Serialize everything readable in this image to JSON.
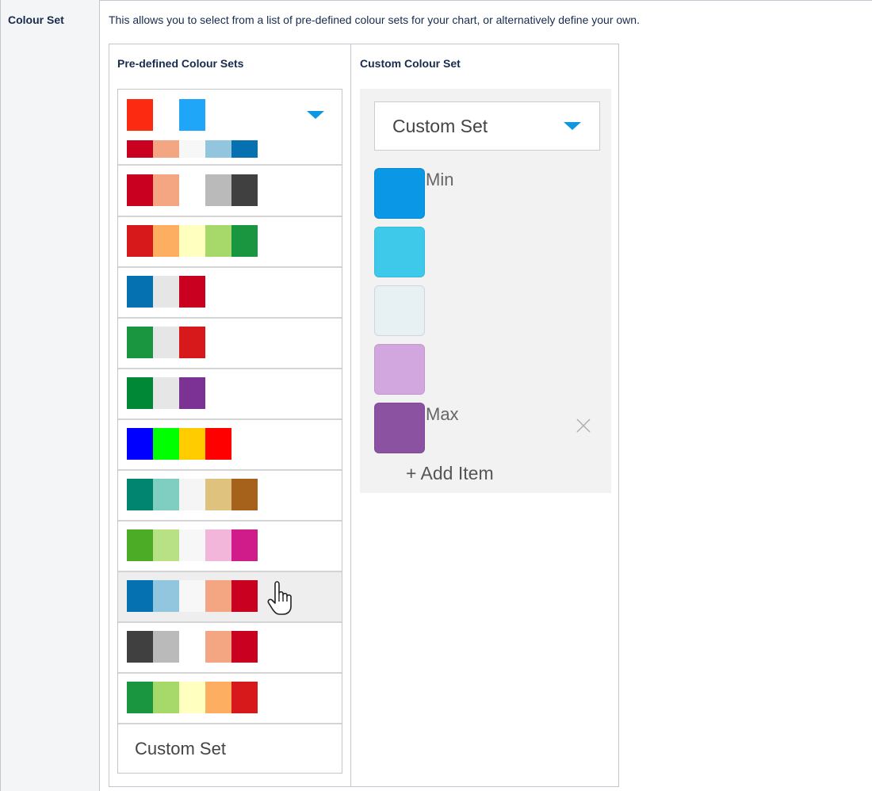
{
  "table": {
    "label": "Colour Set",
    "description": "This allows you to select from a list of pre-defined colour sets for your chart, or alternatively define your own."
  },
  "predefined": {
    "heading": "Pre-defined Colour Sets",
    "selected_swatches": [
      "#fd2a12",
      "#ffffff",
      "#1fa6f9"
    ],
    "sets": [
      [
        "#ca0020",
        "#f4a582",
        "#f7f7f7",
        "#92c5de",
        "#0571b0"
      ],
      [
        "#ca0020",
        "#f4a582",
        "#ffffff",
        "#bababa",
        "#404040"
      ],
      [
        "#d7191c",
        "#fdae61",
        "#ffffbf",
        "#a6d96a",
        "#1a9641"
      ],
      [
        "#0571b0",
        "#e6e6e6",
        "#ca0020"
      ],
      [
        "#1a9641",
        "#e6e6e6",
        "#d7191c"
      ],
      [
        "#008837",
        "#e6e6e6",
        "#7b3294"
      ],
      [
        "#0000ff",
        "#00ff00",
        "#ffcc00",
        "#ff0000"
      ],
      [
        "#018571",
        "#80cdc1",
        "#f5f5f5",
        "#dfc27d",
        "#a6611a"
      ],
      [
        "#4dac26",
        "#b8e186",
        "#f7f7f7",
        "#f1b6da",
        "#d01c8b"
      ],
      [
        "#0571b0",
        "#92c5de",
        "#f7f7f7",
        "#f4a582",
        "#ca0020"
      ],
      [
        "#404040",
        "#bababa",
        "#ffffff",
        "#f4a582",
        "#ca0020"
      ],
      [
        "#1a9641",
        "#a6d96a",
        "#ffffbf",
        "#fdae61",
        "#d7191c"
      ]
    ],
    "custom_option": "Custom Set",
    "hovered_index": 9
  },
  "custom": {
    "heading": "Custom Colour Set",
    "select_value": "Custom Set",
    "items": [
      {
        "color": "#0a97e6",
        "label": "Min"
      },
      {
        "color": "#3ec8ea",
        "label": ""
      },
      {
        "color": "#e7f1f4",
        "label": ""
      },
      {
        "color": "#d2a6de",
        "label": ""
      },
      {
        "color": "#8a52a0",
        "label": "Max"
      }
    ],
    "add_item": "+ Add Item"
  }
}
